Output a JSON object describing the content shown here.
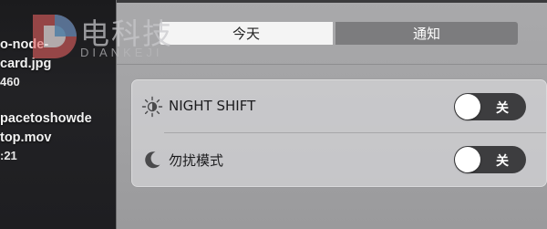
{
  "desktop": {
    "files": [
      {
        "name_line1": "o-node-",
        "name_line2": "card.jpg",
        "meta": "460"
      },
      {
        "name_line1": "pacetoshowde",
        "name_line2": "top.mov",
        "meta": ":21"
      }
    ]
  },
  "watermark": {
    "text": "电科技",
    "sub": "DIANKEJI"
  },
  "notification_center": {
    "tabs": [
      {
        "label": "今天",
        "selected": true
      },
      {
        "label": "通知",
        "selected": false
      }
    ],
    "widgets": [
      {
        "label": "NIGHT SHIFT",
        "icon": "night-shift-icon",
        "toggle_label": "关",
        "on": false
      },
      {
        "label": "勿扰模式",
        "icon": "moon-icon",
        "toggle_label": "关",
        "on": false
      }
    ]
  },
  "colors": {
    "panel_bg": "#a7a7a9",
    "selected_tab_bg": "#f4f4f4",
    "unselected_tab_bg": "#7c7c7e",
    "toggle_off_bg": "#3d3d3f"
  }
}
